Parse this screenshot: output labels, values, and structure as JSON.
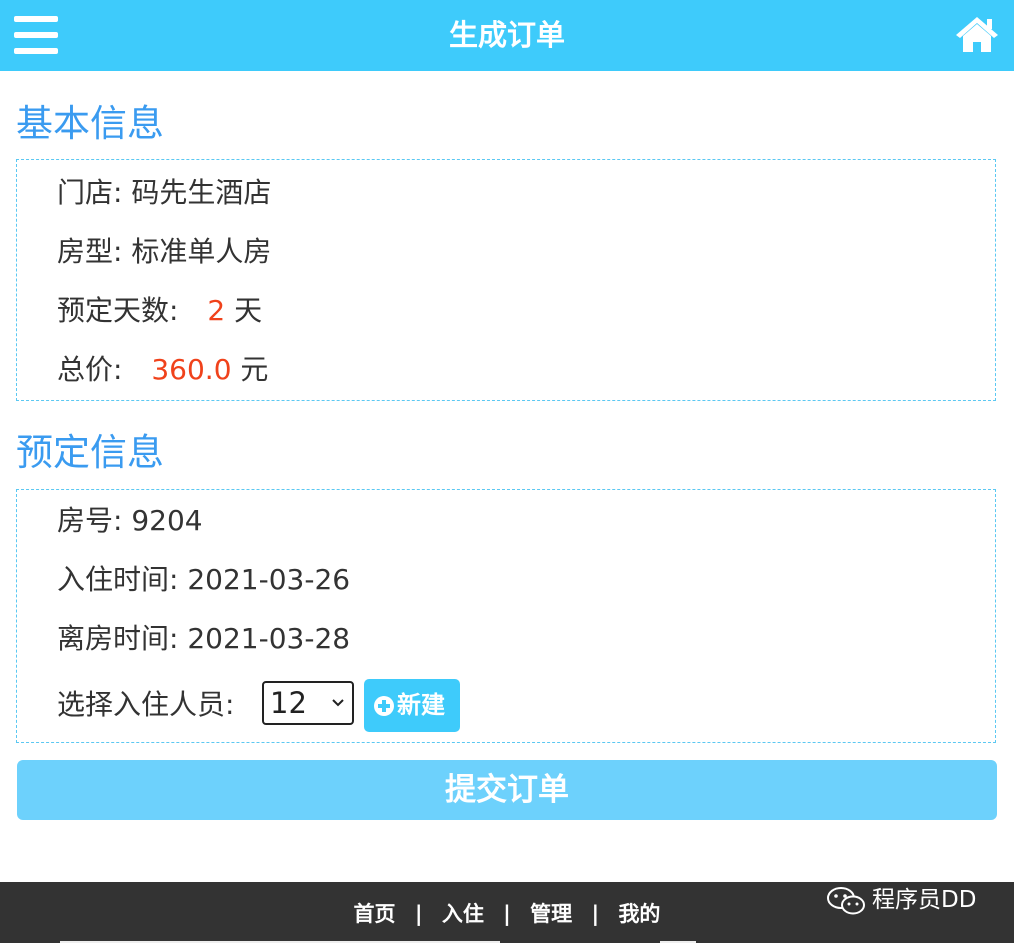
{
  "header": {
    "title": "生成订单",
    "menu_icon": "hamburger-menu-icon",
    "home_icon": "home-icon",
    "bg_color": "#3ecbfb"
  },
  "basic_info": {
    "title": "基本信息",
    "store_label": "门店:",
    "store_value": "码先生酒店",
    "room_type_label": "房型:",
    "room_type_value": "标准单人房",
    "days_label": "预定天数:",
    "days_value": "2",
    "days_unit": "天",
    "total_label": "总价:",
    "total_value": "360.0",
    "total_unit": "元"
  },
  "booking_info": {
    "title": "预定信息",
    "room_no_label": "房号:",
    "room_no_value": "9204",
    "checkin_label": "入住时间:",
    "checkin_value": "2021-03-26",
    "checkout_label": "离房时间:",
    "checkout_value": "2021-03-28",
    "guest_label": "选择入住人员:",
    "guest_selected": "12",
    "new_button": "新建"
  },
  "submit_button": "提交订单",
  "footer": {
    "links": [
      "首页",
      "入住",
      "管理",
      "我的"
    ],
    "separator": "|"
  },
  "watermark": {
    "text": "程序员DD",
    "icon": "wechat-icon"
  },
  "colors": {
    "accent": "#3ecbfb",
    "section_title": "#3a9bf0",
    "highlight": "#f0421b",
    "submit": "#6dd1fc",
    "footer": "#333333"
  }
}
